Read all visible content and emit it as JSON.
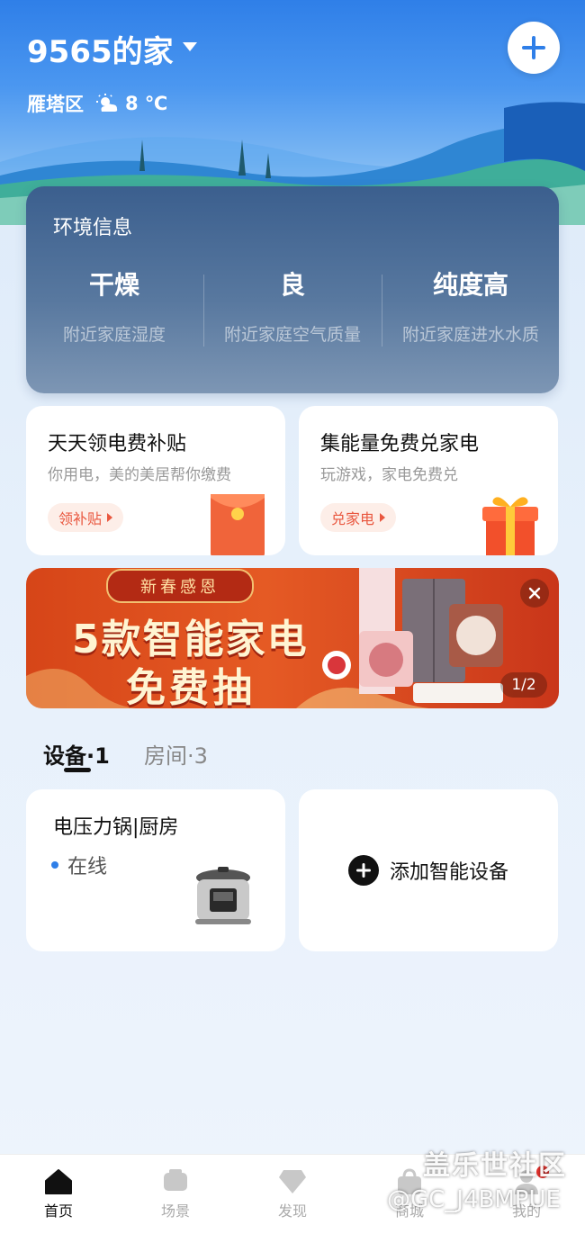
{
  "header": {
    "home_name": "9565的家",
    "district": "雁塔区",
    "temperature": "8 ℃"
  },
  "environment": {
    "title": "环境信息",
    "items": [
      {
        "value": "干燥",
        "desc": "附近家庭湿度"
      },
      {
        "value": "良",
        "desc": "附近家庭空气质量"
      },
      {
        "value": "纯度高",
        "desc": "附近家庭进水水质"
      }
    ]
  },
  "promos": [
    {
      "title": "天天领电费补贴",
      "subtitle": "你用电，美的美居帮你缴费",
      "button": "领补贴"
    },
    {
      "title": "集能量免费兑家电",
      "subtitle": "玩游戏，家电免费兑",
      "button": "兑家电"
    }
  ],
  "banner": {
    "tag": "新春感恩",
    "line1": "5款智能家电",
    "line2": "免费抽",
    "page": "1/2"
  },
  "tabs": [
    {
      "label": "设备·1",
      "active": true
    },
    {
      "label": "房间·3",
      "active": false
    }
  ],
  "devices": [
    {
      "name": "电压力锅|厨房",
      "status": "在线",
      "icon": "pressure-cooker-icon"
    }
  ],
  "add_device_label": "添加智能设备",
  "bottom_nav": [
    {
      "label": "首页",
      "icon": "home-icon",
      "active": true
    },
    {
      "label": "场景",
      "icon": "scene-icon",
      "active": false
    },
    {
      "label": "发现",
      "icon": "discover-icon",
      "active": false
    },
    {
      "label": "商城",
      "icon": "shop-icon",
      "active": false
    },
    {
      "label": "我的",
      "icon": "profile-icon",
      "active": false
    }
  ],
  "watermark": {
    "line1": "盖乐世社区",
    "line2": "@GC_J4BMPUE"
  },
  "colors": {
    "primary_blue": "#2f7fe8",
    "accent_red": "#e9573f"
  }
}
